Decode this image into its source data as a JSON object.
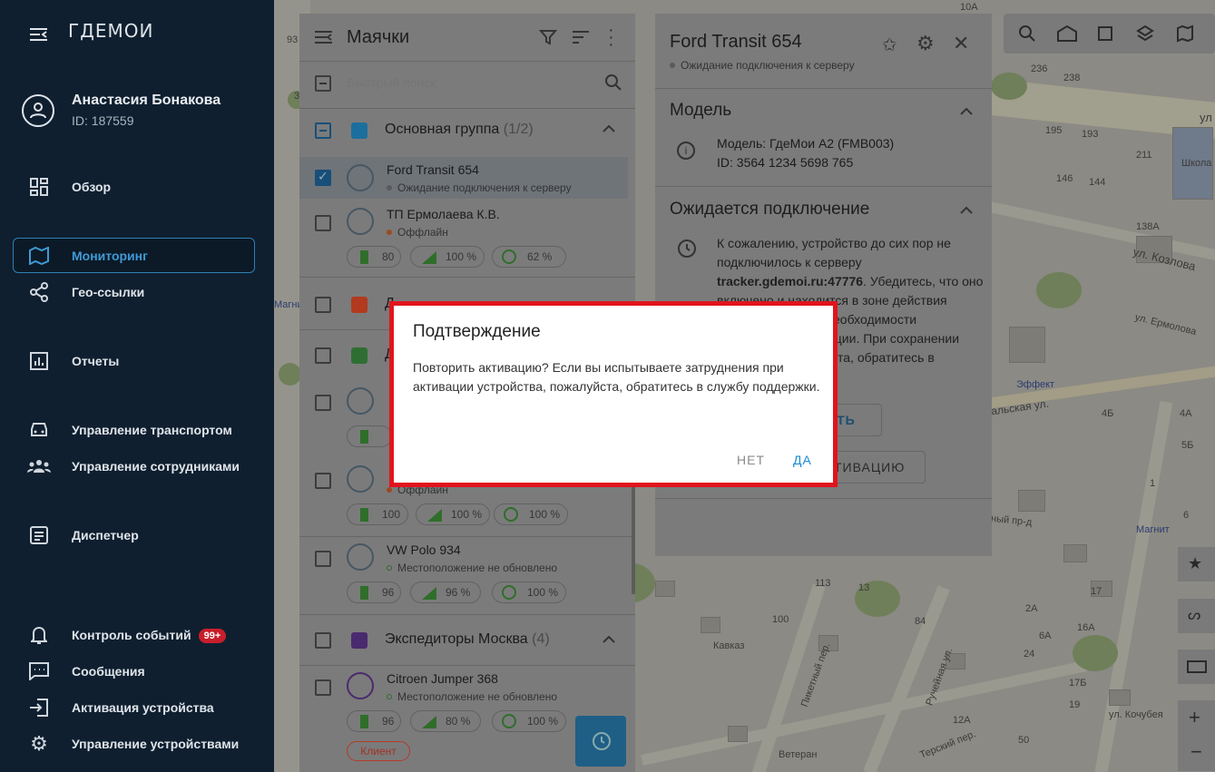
{
  "app": {
    "logo_text": "ГДЕМОИ"
  },
  "user": {
    "name": "Анастасия Бонакова",
    "id": "ID: 187559"
  },
  "sidebar": {
    "items": [
      {
        "label": "Обзор",
        "icon": "dashboard-icon"
      },
      {
        "label": "Мониторинг",
        "icon": "map-icon",
        "active": true
      },
      {
        "label": "Гео-ссылки",
        "icon": "share-icon"
      },
      {
        "label": "Отчеты",
        "icon": "report-icon"
      },
      {
        "label": "Управление транспортом",
        "icon": "car-icon"
      },
      {
        "label": "Управление сотрудниками",
        "icon": "people-icon"
      },
      {
        "label": "Диспетчер",
        "icon": "dispatcher-icon"
      },
      {
        "label": "Контроль событий",
        "icon": "bell-icon",
        "badge": "99+"
      },
      {
        "label": "Сообщения",
        "icon": "message-icon"
      },
      {
        "label": "Активация устройства",
        "icon": "login-icon"
      },
      {
        "label": "Управление устройствами",
        "icon": "gear-icon"
      }
    ]
  },
  "beacons": {
    "title": "Маячки",
    "search_placeholder": "Быстрый поиск",
    "group1": {
      "name": "Основная группа",
      "count": "(1/2)",
      "color": "#1b6f9e"
    },
    "items": [
      {
        "name": "Ford Transit 654",
        "status": "Ожидание подключения к серверу",
        "status_color": "#5a5a5a"
      },
      {
        "name": "ТП Ермолаева К.В.",
        "status": "Оффлайн",
        "status_color": "#9b4a1f",
        "battery": "80",
        "signal": "100 %",
        "gps": "62 %"
      },
      {
        "status": "Оффлайн",
        "status_color": "#9b4a1f",
        "battery": "100",
        "signal": "100 %",
        "gps": "100 %"
      },
      {
        "name": "VW Polo 934",
        "status": "Местоположение не обновлено",
        "status_color": "#2f6e2a",
        "battery": "96",
        "signal": "96 %",
        "gps": "100 %"
      },
      {
        "name": "Citroen Jumper 368",
        "status": "Местоположение не обновлено",
        "status_color": "#2f6e2a",
        "battery": "96",
        "signal": "80 %",
        "gps": "100 %",
        "tag": "Клиент"
      }
    ],
    "group_red": {
      "text": "Д",
      "color": "#b23a1e"
    },
    "group_green": {
      "text": "Д",
      "color": "#2f6e33"
    },
    "group4": {
      "name": "Экспедиторы Москва",
      "count": "(4)",
      "color": "#4a2a6e"
    }
  },
  "details": {
    "title": "Ford Transit 654",
    "status": "Ожидание подключения к серверу",
    "model_header": "Модель",
    "model_line1": "Модель: ГдеМои А2 (FMB003)",
    "model_line2": "ID: 3564 1234 5698 765",
    "wait_header": "Ожидается подключение",
    "wait_line1": "К сожалению, устройство до сих пор не",
    "wait_line2": "подключилось к серверу",
    "wait_server": "tracker.gdemoi.ru:47776",
    "wait_line3": ". Убедитесь, что оно",
    "wait_line4": "включено и находится в зоне действия",
    "wait_line5": "еобходимости",
    "wait_line6": "ации. При сохранении",
    "wait_line7": "ста, обратитесь в",
    "btn_partial": "ИТЬ",
    "btn_partial2": "ТИВАЦИЮ"
  },
  "dialog": {
    "title": "Подтверждение",
    "text": "Повторить активацию? Если вы испытываете затруднения при активации устройства, пожалуйста, обратитесь в службу поддержки.",
    "no": "НЕТ",
    "yes": "ДА",
    "accent": "#1b8ad4",
    "highlight": "#e1141c"
  },
  "map": {
    "labels": [
      "93",
      "236",
      "238",
      "3",
      "ул",
      "195",
      "193",
      "146",
      "144",
      "211",
      "Школа",
      "138А",
      "ул. Козлова",
      "ул. Ермолова",
      "Эффект",
      "альская ул.",
      "Магнит",
      "Магнит",
      "4Б",
      "4А",
      "ный пр-д",
      "Кавказ",
      "Пикетный пер.",
      "Ручейная ул.",
      "Терский пер.",
      "ул. Кочубея",
      "Ветеран",
      "113",
      "100",
      "84",
      "13",
      "17Б",
      "12А",
      "10А",
      "16А",
      "6",
      "1",
      "24",
      "17",
      "19",
      "6А",
      "2А",
      "50",
      "5Б"
    ]
  }
}
